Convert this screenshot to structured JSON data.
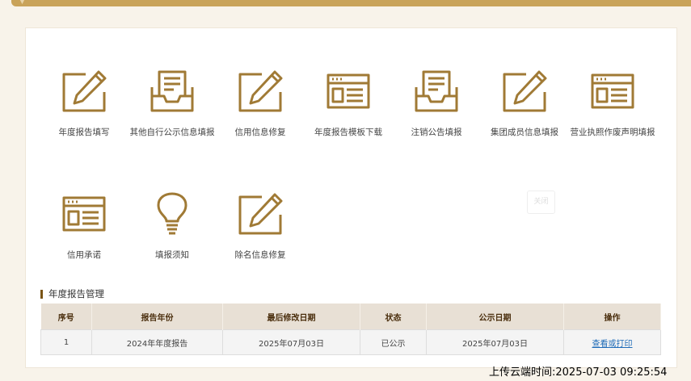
{
  "tiles_row1": [
    {
      "label": "年度报告填写",
      "icon": "pen-square-icon"
    },
    {
      "label": "其他自行公示信息填报",
      "icon": "document-tray-icon"
    },
    {
      "label": "信用信息修复",
      "icon": "pen-square-icon"
    },
    {
      "label": "年度报告模板下载",
      "icon": "web-card-icon"
    },
    {
      "label": "注销公告填报",
      "icon": "document-tray-icon"
    },
    {
      "label": "集团成员信息填报",
      "icon": "pen-square-icon"
    },
    {
      "label": "营业执照作废声明填报",
      "icon": "web-card-icon"
    }
  ],
  "tiles_row2": [
    {
      "label": "信用承诺",
      "icon": "web-card-icon"
    },
    {
      "label": "填报须知",
      "icon": "lightbulb-icon"
    },
    {
      "label": "除名信息修复",
      "icon": "pen-square-icon"
    }
  ],
  "ghost_button": {
    "label": "关闭"
  },
  "section": {
    "title": "年度报告管理"
  },
  "table": {
    "headers": [
      "序号",
      "报告年份",
      "最后修改日期",
      "状态",
      "公示日期",
      "操作"
    ],
    "rows": [
      {
        "index": "1",
        "year": "2024年年度报告",
        "modified": "2025年07月03日",
        "status": "已公示",
        "published": "2025年07月03日",
        "action": "查看或打印"
      }
    ]
  },
  "upload_time": "上传云端时间:2025-07-03 09:25:54",
  "colors": {
    "accent": "#a07a35",
    "topbar": "#c9a35a",
    "header_bg": "#e8e0d5",
    "link": "#1e6bb8"
  }
}
